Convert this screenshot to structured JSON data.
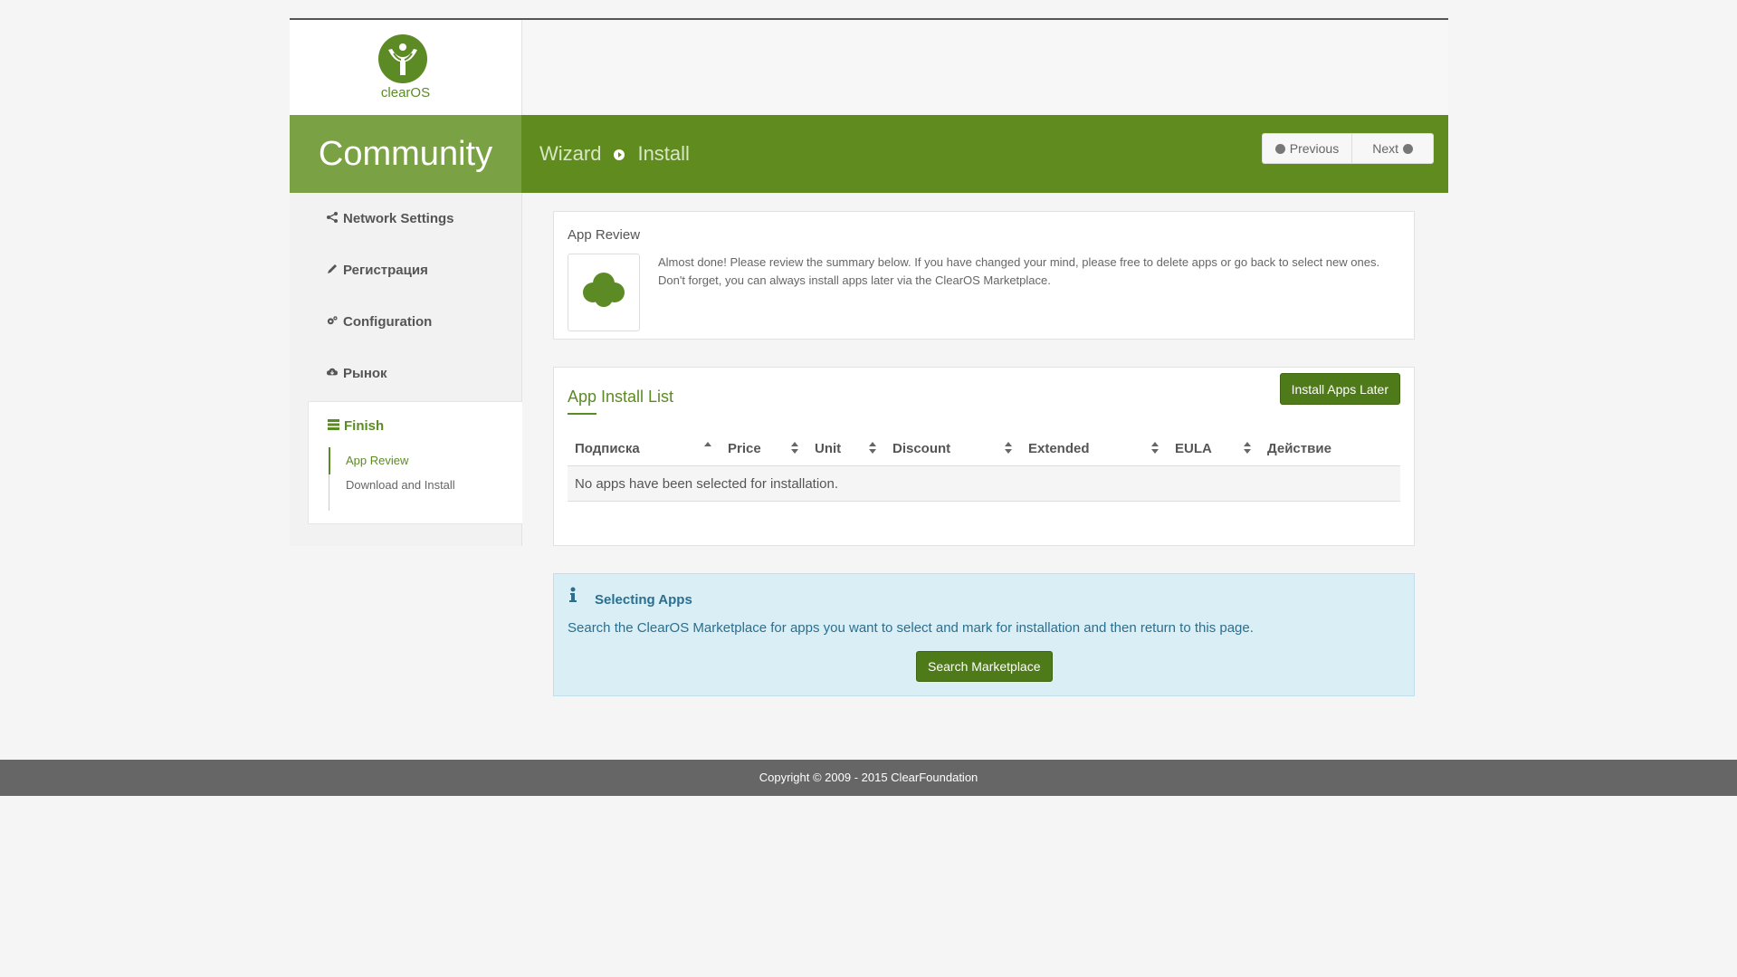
{
  "brand": {
    "logo_text": "clearOS",
    "edition": "Community",
    "accent": "#608c1f"
  },
  "breadcrumb": {
    "root": "Wizard",
    "current": "Install"
  },
  "nav": {
    "previous": "Previous",
    "next": "Next"
  },
  "sidebar": {
    "items": [
      {
        "label": "Network Settings",
        "icon": "share-icon"
      },
      {
        "label": "Регистрация",
        "icon": "pencil-icon"
      },
      {
        "label": "Configuration",
        "icon": "cogs-icon"
      },
      {
        "label": "Рынок",
        "icon": "cloud-download-icon"
      }
    ],
    "finish": {
      "label": "Finish",
      "sub": [
        "App Review",
        "Download and Install"
      ]
    }
  },
  "review": {
    "title": "App Review",
    "desc": "Almost done! Please review the summary below. If you have changed your mind, please free to delete apps or go back to select new ones. Don't forget, you can always install apps later via the ClearOS Marketplace."
  },
  "install_list": {
    "title": "App Install List",
    "later_button": "Install Apps Later",
    "columns": [
      "Подписка",
      "Price",
      "Unit",
      "Discount",
      "Extended",
      "EULA",
      "Действие"
    ],
    "empty": "No apps have been selected for installation."
  },
  "info": {
    "title": "Selecting Apps",
    "text": "Search the ClearOS Marketplace for apps you want to select and mark for installation and then return to this page.",
    "button": "Search Marketplace"
  },
  "footer": {
    "copyright": "Copyright © 2009 - 2015 ClearFoundation"
  }
}
